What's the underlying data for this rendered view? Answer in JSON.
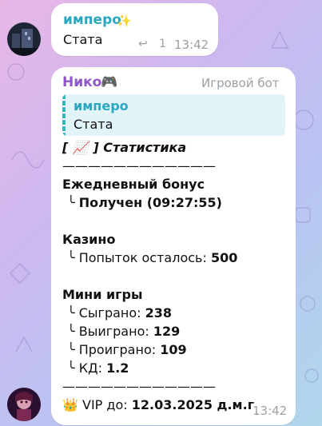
{
  "colors": {
    "author1": "#2aa7c1",
    "author2": "#8f57c7",
    "quote_bg": "#e3f4f8",
    "quote_accent": "#3bb2c4"
  },
  "msg1": {
    "author": "имперо",
    "badge": "🤩",
    "text": "Стата",
    "reply_count": "1",
    "time": "13:42"
  },
  "msg2": {
    "author": "Нико",
    "author_emoji": "🎮",
    "role": "Игровой бот",
    "quote_author": "имперо",
    "quote_text": "Стата",
    "header_left": "[",
    "header_icon": "📈",
    "header_right": "] Статистика",
    "divider": "————————————",
    "daily_title": "Ежедневный бонус",
    "daily_prefix": "╰",
    "daily_value": "Получен (09:27:55)",
    "casino_title": "Казино",
    "casino_prefix": "╰",
    "casino_label": "Попыток осталось:",
    "casino_value": "500",
    "mini_title": "Мини игры",
    "mini_rows": [
      {
        "label": "Сыграно:",
        "value": "238"
      },
      {
        "label": "Выиграно:",
        "value": "129"
      },
      {
        "label": "Проиграно:",
        "value": "109"
      },
      {
        "label": "КД:",
        "value": "1.2"
      }
    ],
    "divider2": "————————————",
    "vip_icon": "👑",
    "vip_label": "VIP до:",
    "vip_value": "12.03.2025 д.м.г",
    "time": "13:42"
  }
}
